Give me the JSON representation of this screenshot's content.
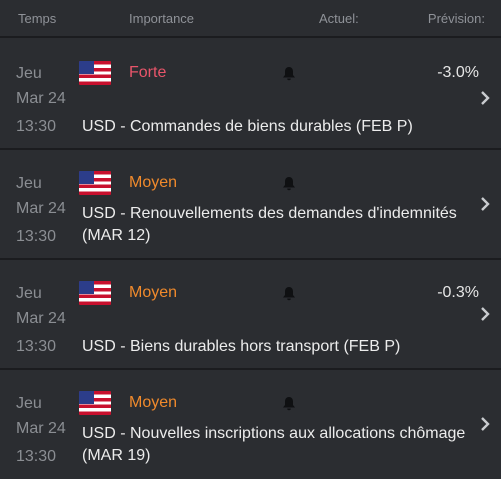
{
  "header": {
    "time": "Temps",
    "importance": "Importance",
    "actual": "Actuel:",
    "forecast": "Prévision:"
  },
  "colors": {
    "high": "#e8556a",
    "medium": "#f08a2c",
    "background": "#2b2d31",
    "divider": "#1b1c1f"
  },
  "events": [
    {
      "day": "Jeu",
      "date": "Mar 24",
      "time": "13:30",
      "flag_icon": "us-flag-icon",
      "importance": "Forte",
      "importance_level": "high",
      "actual": "-3.0%",
      "title": "USD - Commandes de biens durables (FEB P)"
    },
    {
      "day": "Jeu",
      "date": "Mar 24",
      "time": "13:30",
      "flag_icon": "us-flag-icon",
      "importance": "Moyen",
      "importance_level": "medium",
      "actual": "",
      "title": "USD - Renouvellements des demandes d'indemnités (MAR 12)"
    },
    {
      "day": "Jeu",
      "date": "Mar 24",
      "time": "13:30",
      "flag_icon": "us-flag-icon",
      "importance": "Moyen",
      "importance_level": "medium",
      "actual": "-0.3%",
      "title": "USD - Biens durables hors transport (FEB P)"
    },
    {
      "day": "Jeu",
      "date": "Mar 24",
      "time": "13:30",
      "flag_icon": "us-flag-icon",
      "importance": "Moyen",
      "importance_level": "medium",
      "actual": "",
      "title": "USD - Nouvelles inscriptions aux allocations chômage (MAR 19)"
    }
  ]
}
